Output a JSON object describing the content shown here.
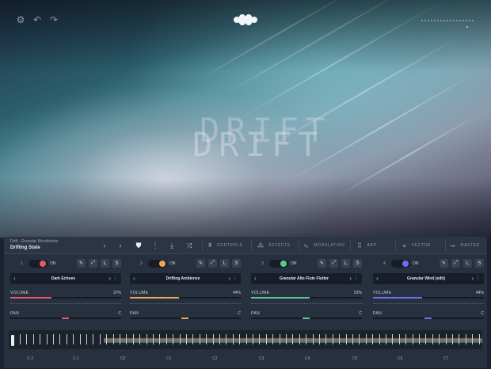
{
  "topbar": {
    "settings_icon": "gear-icon",
    "undo_icon": "undo-icon",
    "redo_icon": "redo-icon",
    "logo_icon": "brand-logo-icon"
  },
  "hero": {
    "title": "DRIFT"
  },
  "header": {
    "preset_path": "Drift - Granular Woodwinds",
    "preset_name": "Drifting State",
    "tabs": [
      {
        "label": "CONTROLS",
        "icon": "waveform-icon"
      },
      {
        "label": "EFFECTS",
        "icon": "fx-icon"
      },
      {
        "label": "MODULATION",
        "icon": "modulation-icon"
      },
      {
        "label": "ARP",
        "icon": "arp-icon"
      },
      {
        "label": "VECTOR",
        "icon": "vector-icon"
      },
      {
        "label": "MASTER",
        "icon": "master-icon"
      }
    ]
  },
  "layers": [
    {
      "number": "1",
      "on_label": "ON",
      "color": "#e05a6a",
      "preset": "Dark Echoes",
      "volume_label": "VOLUME",
      "volume_value": "37%",
      "volume": 0.37,
      "pan_label": "PAN",
      "pan_value": "C",
      "btn_l": "L",
      "btn_s": "S"
    },
    {
      "number": "2",
      "on_label": "ON",
      "color": "#f0a850",
      "preset": "Drifting Ambience",
      "volume_label": "VOLUME",
      "volume_value": "44%",
      "volume": 0.44,
      "pan_label": "PAN",
      "pan_value": "C",
      "btn_l": "L",
      "btn_s": "S"
    },
    {
      "number": "3",
      "on_label": "ON",
      "color": "#5cc98a",
      "preset": "Granular Alto Flute Flutter",
      "volume_label": "VOLUME",
      "volume_value": "53%",
      "volume": 0.53,
      "pan_label": "PAN",
      "pan_value": "C",
      "btn_l": "L",
      "btn_s": "S"
    },
    {
      "number": "4",
      "on_label": "ON",
      "color": "#6c6ef0",
      "preset": "Granular Wind (edit)",
      "volume_label": "VOLUME",
      "volume_value": "44%",
      "volume": 0.44,
      "pan_label": "PAN",
      "pan_value": "C",
      "btn_l": "L",
      "btn_s": "S"
    }
  ],
  "keyboard": {
    "octaves": [
      "C-2",
      "C-1",
      "C0",
      "C1",
      "C2",
      "C3",
      "C4",
      "C5",
      "C6",
      "C7"
    ]
  }
}
